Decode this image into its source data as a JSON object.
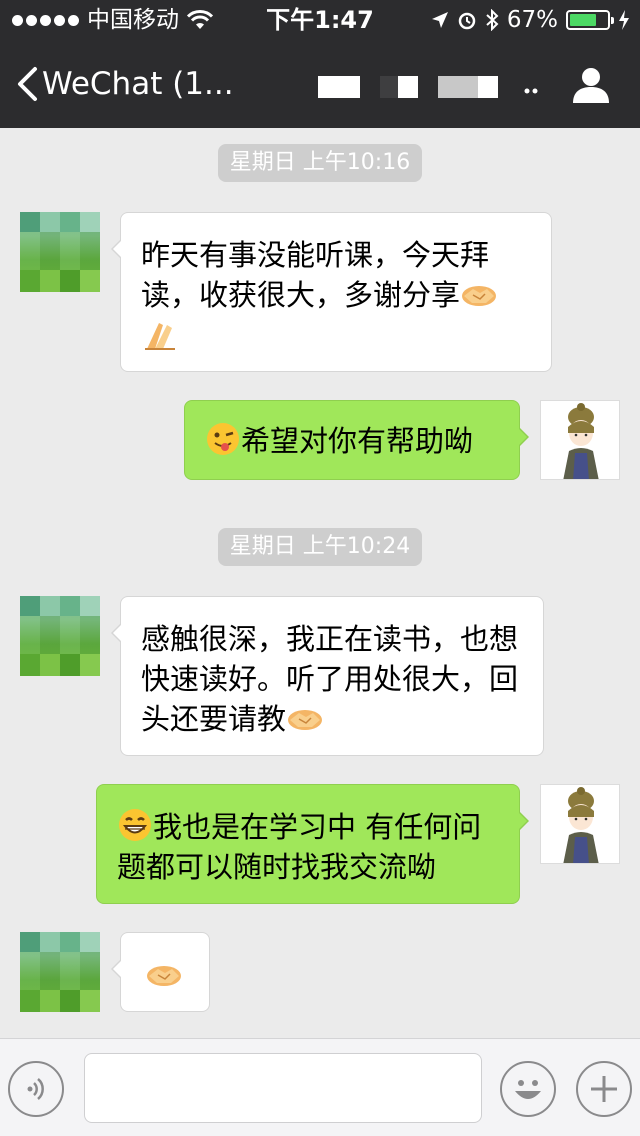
{
  "status_bar": {
    "carrier": "中国移动",
    "time": "下午1:47",
    "battery_percent": "67%",
    "battery_level": 0.67,
    "signal_bars": 5,
    "icons": [
      "signal-icon",
      "wifi-icon",
      "location-icon",
      "alarm-icon",
      "bluetooth-icon",
      "battery-icon",
      "charging-icon"
    ]
  },
  "nav": {
    "back_label": "WeChat (1...",
    "title_obscured": true,
    "user_icon": "person-icon"
  },
  "messages": [
    {
      "kind": "timestamp",
      "text": "星期日 上午10:16"
    },
    {
      "kind": "message",
      "direction": "incoming",
      "text": "昨天有事没能听课，今天拜读，收获很大，多谢分享",
      "emoji_after": [
        "handshake",
        "clap"
      ]
    },
    {
      "kind": "message",
      "direction": "outgoing",
      "emoji_before": "wink-tongue",
      "text": "希望对你有帮助呦"
    },
    {
      "kind": "timestamp",
      "text": "星期日 上午10:24"
    },
    {
      "kind": "message",
      "direction": "incoming",
      "text": "感触很深，我正在读书，也想快速读好。听了用处很大，回头还要请教",
      "emoji_after": [
        "handshake"
      ]
    },
    {
      "kind": "message",
      "direction": "outgoing",
      "emoji_before": "grin",
      "text": "我也是在学习中  有任何问题都可以随时找我交流呦"
    },
    {
      "kind": "message",
      "direction": "incoming",
      "text": "",
      "emoji_after": [
        "handshake"
      ]
    }
  ],
  "input_bar": {
    "voice_icon": "voice-icon",
    "emoji_icon": "emoji-icon",
    "plus_icon": "plus-icon",
    "text_value": ""
  },
  "colors": {
    "bar_bg": "#2c2c2e",
    "chat_bg": "#ebebeb",
    "outgoing_bubble": "#a0e75a",
    "incoming_bubble": "#ffffff",
    "battery_fill": "#4cd964",
    "timestamp_bg": "#cecece"
  }
}
